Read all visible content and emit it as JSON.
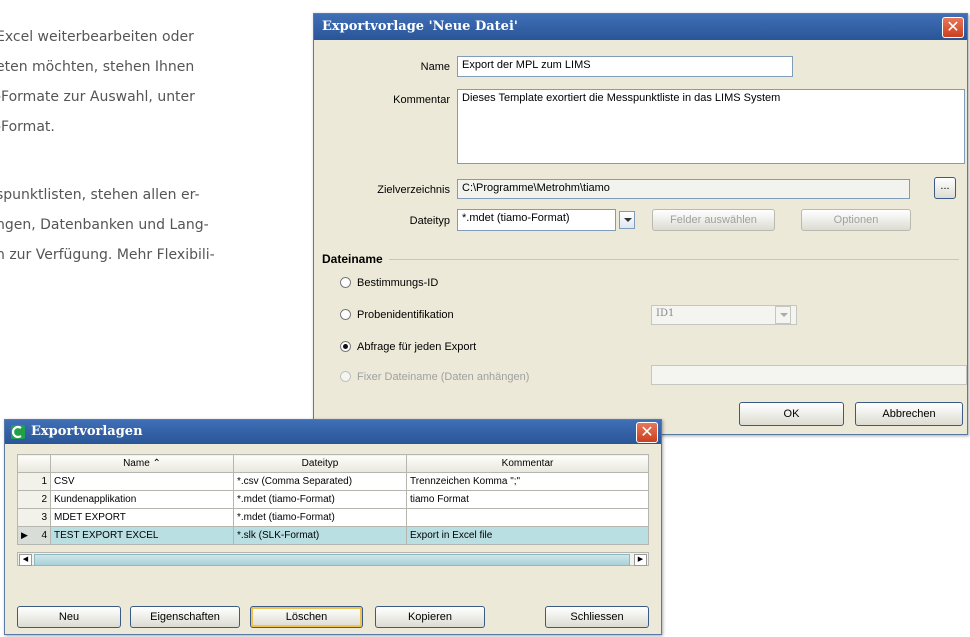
{
  "background_text": {
    "paragraph1": "Excel weiterbearbeiten oder\neten möchten, stehen Ihnen\n-Formate zur Auswahl, unter\n-Format.",
    "paragraph2": "spunktlisten, stehen allen er-\nngen, Datenbanken und Lang-\nn zur Verfügung. Mehr Flexibili-"
  },
  "export_dialog": {
    "title": "Exportvorlage 'Neue Datei'",
    "name_label": "Name",
    "name_value": "Export der MPL zum LIMS",
    "comment_label": "Kommentar",
    "comment_value": "Dieses Template exortiert die Messpunktliste in das LIMS System",
    "dir_label": "Zielverzeichnis",
    "dir_value": "C:\\Programme\\Metrohm\\tiamo",
    "browse_label": "...",
    "filetype_label": "Dateityp",
    "filetype_value": "*.mdet (tiamo-Format)",
    "select_fields_label": "Felder auswählen",
    "options_label": "Optionen",
    "filename_section": "Dateiname",
    "radio_determination": "Bestimmungs-ID",
    "radio_sample": "Probenidentifikation",
    "sample_select_value": "ID1",
    "radio_each_export": "Abfrage für jeden Export",
    "radio_fixed": "Fixer Dateiname (Daten anhängen)",
    "ok_label": "OK",
    "cancel_label": "Abbrechen",
    "close_glyph": "✕"
  },
  "templates_window": {
    "title": "Exportvorlagen",
    "close_glyph": "✕",
    "columns": [
      "",
      "Name ⌃",
      "Dateityp",
      "Kommentar"
    ],
    "rows": [
      {
        "num": "1",
        "name": "CSV",
        "type": "*.csv (Comma Separated)",
        "comment": "Trennzeichen Komma \";\"",
        "marker": ""
      },
      {
        "num": "2",
        "name": "Kundenapplikation",
        "type": "*.mdet (tiamo-Format)",
        "comment": "tiamo Format",
        "marker": ""
      },
      {
        "num": "3",
        "name": "MDET EXPORT",
        "type": "*.mdet (tiamo-Format)",
        "comment": "",
        "marker": ""
      },
      {
        "num": "4",
        "name": "TEST EXPORT EXCEL",
        "type": "*.slk (SLK-Format)",
        "comment": "Export in Excel file",
        "marker": "▶"
      }
    ],
    "buttons": {
      "new": "Neu",
      "properties": "Eigenschaften",
      "delete": "Löschen",
      "copy": "Kopieren",
      "close": "Schliessen"
    }
  }
}
